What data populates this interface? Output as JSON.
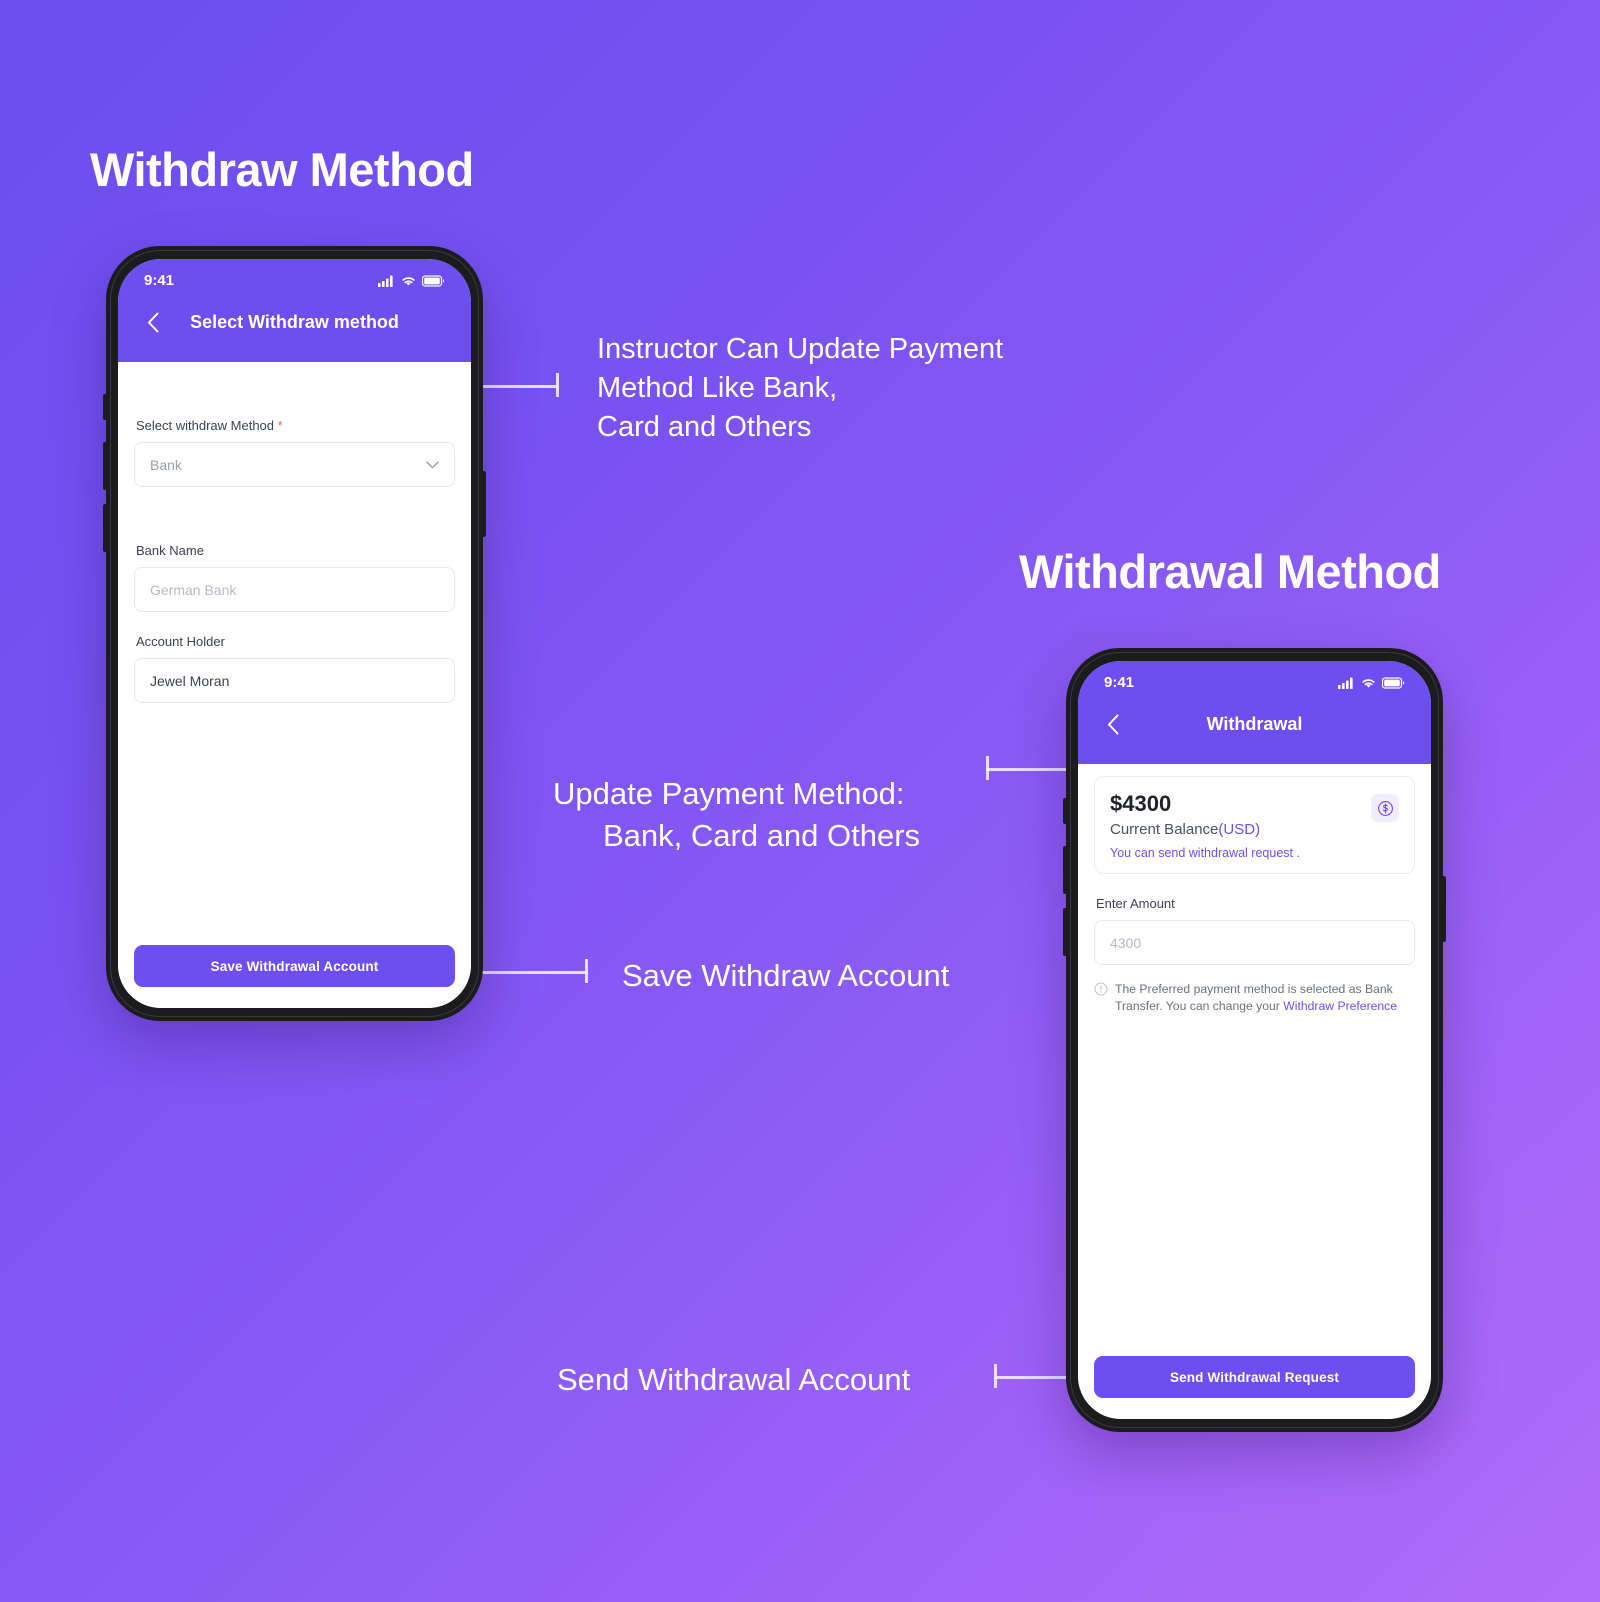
{
  "theme": {
    "background_gradient_from": "#6a4ef0",
    "background_gradient_to": "#b06cf9",
    "accent": "#6c4ff0",
    "link": "#6c4ff0",
    "required_marker": "#f4606c"
  },
  "headings": {
    "left": "Withdraw Method",
    "right": "Withdrawal Method"
  },
  "annotations": {
    "instructor_update": "Instructor Can Update Payment\nMethod Like Bank,\nCard and Others",
    "update_payment_line1": "Update Payment Method:",
    "update_payment_line2": "Bank, Card and Others",
    "save_withdraw": "Save Withdraw Account",
    "send_withdrawal": "Send Withdrawal Account"
  },
  "phone_left": {
    "status_bar": {
      "time": "9:41",
      "icons": [
        "signal-icon",
        "wifi-icon",
        "battery-icon"
      ]
    },
    "appbar": {
      "back_icon": "chevron-left-icon",
      "title": "Select Withdraw method"
    },
    "form": {
      "method_label": "Select withdraw Method",
      "method_required_marker": "*",
      "method_value": "Bank",
      "method_chevron": "chevron-down-icon",
      "bank_name_label": "Bank Name",
      "bank_name_placeholder": "German Bank",
      "account_holder_label": "Account Holder",
      "account_holder_value": "Jewel Moran"
    },
    "cta_label": "Save Withdrawal Account"
  },
  "phone_right": {
    "status_bar": {
      "time": "9:41",
      "icons": [
        "signal-icon",
        "wifi-icon",
        "battery-icon"
      ]
    },
    "appbar": {
      "back_icon": "chevron-left-icon",
      "title": "Withdrawal"
    },
    "balance_card": {
      "amount": "$4300",
      "label_main": "Current Balance",
      "label_currency": "(USD)",
      "note": "You can send withdrawal request .",
      "badge_icon": "dollar-circle-icon"
    },
    "amount_field": {
      "label": "Enter Amount",
      "placeholder": "4300"
    },
    "info_note": {
      "icon": "info-circle-icon",
      "text": "The Preferred payment method is selected as Bank Transfer. You can change your ",
      "link_text": "Withdraw Preference"
    },
    "cta_label": "Send Withdrawal Request"
  }
}
